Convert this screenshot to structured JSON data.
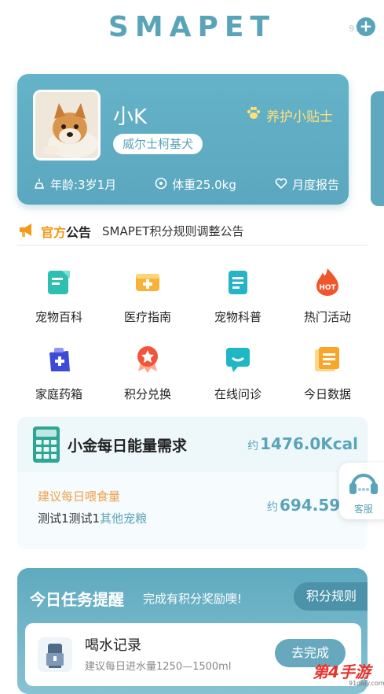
{
  "header": {
    "logo": "SMAPET",
    "add_icon": "plus-icon",
    "ghost_text": "91"
  },
  "pet": {
    "name": "小K",
    "breed": "威尔士柯基犬",
    "tips_label": "养护小贴士",
    "stats": {
      "age": "年龄:3岁1月",
      "weight": "体重25.0kg",
      "report": "月度报告"
    }
  },
  "announcement": {
    "title_a": "官方",
    "title_b": "公告",
    "text": "SMAPET积分规则调整公告"
  },
  "grid": [
    {
      "label": "宠物百科",
      "icon": "encyclopedia-icon"
    },
    {
      "label": "医疗指南",
      "icon": "medical-guide-icon"
    },
    {
      "label": "宠物科普",
      "icon": "science-icon"
    },
    {
      "label": "热门活动",
      "icon": "hot-icon"
    },
    {
      "label": "家庭药箱",
      "icon": "medicine-kit-icon"
    },
    {
      "label": "积分兑换",
      "icon": "points-icon"
    },
    {
      "label": "在线问诊",
      "icon": "chat-icon"
    },
    {
      "label": "今日数据",
      "icon": "data-icon"
    }
  ],
  "energy": {
    "title": "小金每日能量需求",
    "kcal_prefix": "约",
    "kcal_value": "1476.0Kcal",
    "feed_label": "建议每日喂食量",
    "feed_prefix": "约",
    "feed_value": "694.59",
    "foods_main": "测试1测试1",
    "foods_other": "其他宠粮"
  },
  "service": {
    "label": "客服"
  },
  "task": {
    "title": "今日任务提醒",
    "subtitle": "完成有积分奖励噢!",
    "rules": "积分规则",
    "item": {
      "name": "喝水记录",
      "desc": "建议每日进水量1250—1500ml",
      "button": "去完成"
    }
  },
  "watermark": {
    "text": "第4手游",
    "sub": "91dajy.com"
  },
  "colors": {
    "accent": "#5aa4ba",
    "orange": "#f29a1a",
    "gold": "#ffe07a"
  }
}
